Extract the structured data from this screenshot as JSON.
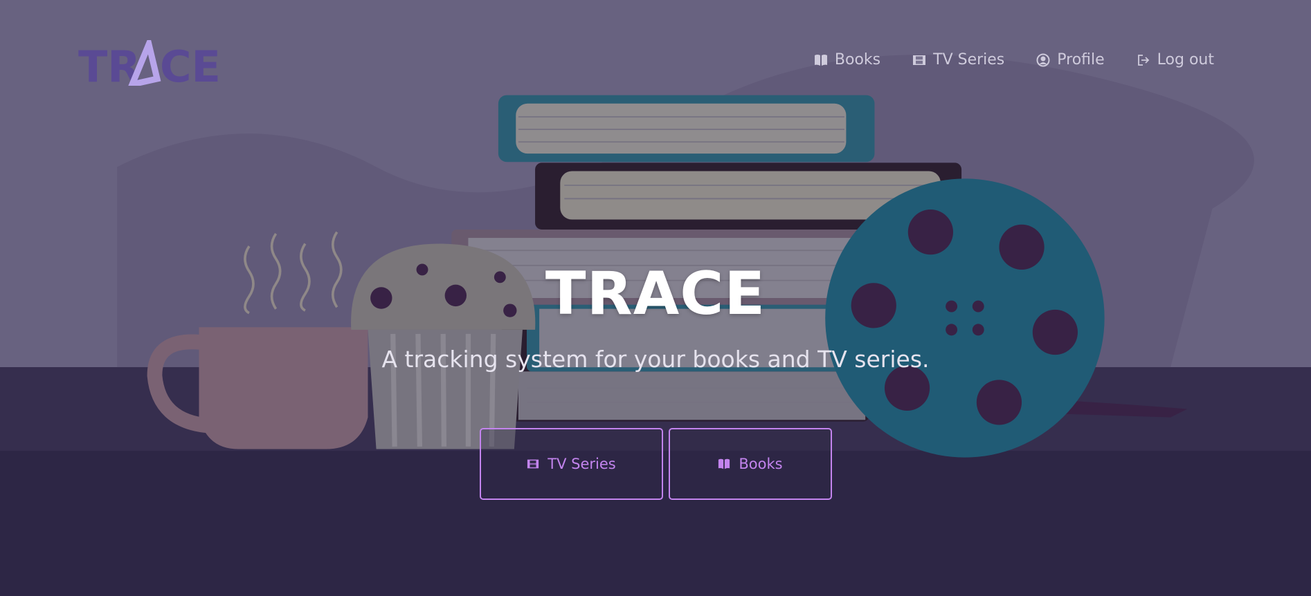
{
  "brand": {
    "logo_text": "TRACE",
    "color": "#5a4a94",
    "accent": "#b7a4ea"
  },
  "nav": {
    "items": [
      {
        "label": "Books",
        "icon": "book-open-icon"
      },
      {
        "label": "TV Series",
        "icon": "film-icon"
      },
      {
        "label": "Profile",
        "icon": "user-circle-icon"
      },
      {
        "label": "Log out",
        "icon": "sign-out-icon"
      }
    ]
  },
  "hero": {
    "title": "TRACE",
    "subtitle": "A tracking system for your books and TV series.",
    "buttons": [
      {
        "label": "TV Series",
        "icon": "film-icon"
      },
      {
        "label": "Books",
        "icon": "book-open-icon"
      }
    ],
    "button_color": "#c384ee"
  }
}
